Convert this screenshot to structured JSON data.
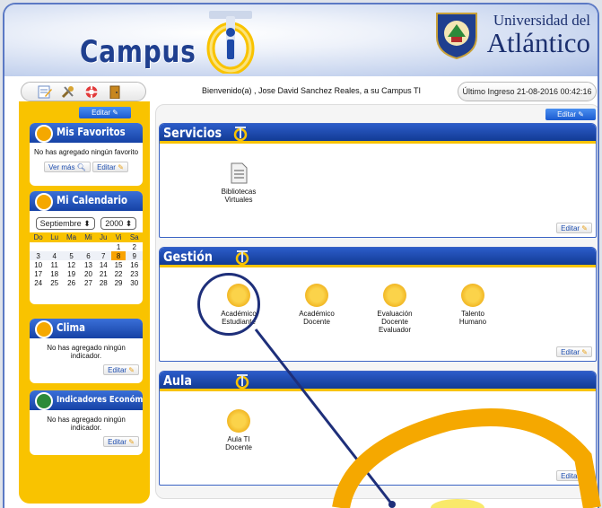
{
  "header": {
    "logo_text": "Campus",
    "university_line1": "Universidad del",
    "university_line2": "Atlántico"
  },
  "toolbar": {
    "welcome": "Bienvenido(a) , Jose David Sanchez Reales, a su Campus TI",
    "last_login": "Último Ingreso 21-08-2016 00:42:16",
    "icons": [
      "edit-note-icon",
      "tools-icon",
      "help-lifebuoy-icon",
      "exit-door-icon"
    ]
  },
  "sidebar": {
    "edit_label": "Editar",
    "favoritos": {
      "title": "Mis Favoritos",
      "message": "No has agregado ningún favorito",
      "see_more": "Ver más",
      "edit": "Editar"
    },
    "calendario": {
      "title": "Mi Calendario",
      "month": "Septiembre",
      "year": "2000",
      "days": [
        "Do",
        "Lu",
        "Ma",
        "Mi",
        "Ju",
        "Vi",
        "Sa"
      ],
      "weeks": [
        [
          "",
          "",
          "",
          "",
          "",
          "1",
          "2"
        ],
        [
          "3",
          "4",
          "5",
          "6",
          "7",
          "8",
          "9"
        ],
        [
          "10",
          "11",
          "12",
          "13",
          "14",
          "15",
          "16"
        ],
        [
          "17",
          "18",
          "19",
          "20",
          "21",
          "22",
          "23"
        ],
        [
          "24",
          "25",
          "26",
          "27",
          "28",
          "29",
          "30"
        ]
      ],
      "selected_day": "8"
    },
    "clima": {
      "title": "Clima",
      "message": "No has agregado ningún indicador.",
      "edit": "Editar"
    },
    "indicadores": {
      "title": "Indicadores Económicos",
      "message": "No has agregado ningún indicador.",
      "edit": "Editar"
    }
  },
  "main": {
    "edit_label": "Editar",
    "servicios": {
      "title": "Servicios",
      "edit": "Editar",
      "apps": [
        {
          "label_1": "Bibliotecas",
          "label_2": "Virtuales",
          "label_3": ""
        }
      ]
    },
    "gestion": {
      "title": "Gestión",
      "edit": "Editar",
      "apps": [
        {
          "label_1": "Académico",
          "label_2": "Estudiante",
          "label_3": ""
        },
        {
          "label_1": "Académico",
          "label_2": "Docente",
          "label_3": ""
        },
        {
          "label_1": "Evaluación",
          "label_2": "Docente",
          "label_3": "Evaluador"
        },
        {
          "label_1": "Talento",
          "label_2": "Humano",
          "label_3": ""
        }
      ]
    },
    "aula": {
      "title": "Aula",
      "edit": "Editar",
      "apps": [
        {
          "label_1": "Aula TI",
          "label_2": "Docente",
          "label_3": ""
        }
      ]
    }
  },
  "colors": {
    "brand_blue": "#1642a5",
    "brand_yellow": "#f9c300",
    "highlight_circle": "#1e2f7a",
    "magnifier": "#f5a800"
  }
}
